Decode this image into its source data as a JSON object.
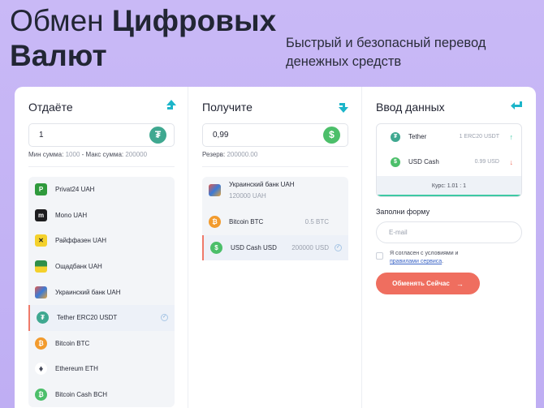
{
  "hero": {
    "title_light": "Обмен",
    "title_bold_1": "Цифровых",
    "title_bold_2": "Валют",
    "subtitle": "Быстрый и безопасный перевод денежных средств"
  },
  "give": {
    "title": "Отдаёте",
    "amount": "1",
    "currency_icon": "tether-icon",
    "min_label": "Мин сумма:",
    "min_value": "1000",
    "max_label": "- Макс сумма:",
    "max_value": "200000",
    "items": [
      {
        "label": "Privat24 UAH",
        "icon": "privat24-icon",
        "color": "#2f9a3c"
      },
      {
        "label": "Mono UAH",
        "icon": "monobank-icon",
        "color": "#1d1d1f"
      },
      {
        "label": "Райффазен UAH",
        "icon": "raiffeisen-icon",
        "color": "#f4d12c"
      },
      {
        "label": "Ощадбанк UAH",
        "icon": "oschadbank-icon",
        "color": "#2f8f4a"
      },
      {
        "label": "Украинский банк UAH",
        "icon": "ukrbank-icon",
        "color": "#e3a13a"
      },
      {
        "label": "Tether ERC20 USDT",
        "icon": "tether-icon",
        "color": "#3fa890",
        "active": true
      },
      {
        "label": "Bitcoin BTC",
        "icon": "bitcoin-icon",
        "color": "#f29b2e"
      },
      {
        "label": "Ethereum ETH",
        "icon": "ethereum-icon",
        "color": "#454a5a"
      },
      {
        "label": "Bitcoin Cash BCH",
        "icon": "bitcoin-cash-icon",
        "color": "#4cbf6a"
      }
    ]
  },
  "get": {
    "title": "Получите",
    "amount": "0,99",
    "currency_icon": "usd-icon",
    "reserve_label": "Резерв:",
    "reserve_value": "200000.00",
    "items": [
      {
        "label": "Украинский банк UAH",
        "sub": "120000 UAH",
        "icon": "ukrbank-icon",
        "color": "#e3a13a"
      },
      {
        "label": "Bitcoin BTC",
        "amount": "0.5 BTC",
        "icon": "bitcoin-icon",
        "color": "#f29b2e"
      },
      {
        "label": "USD Cash USD",
        "amount": "200000 USD",
        "icon": "usd-icon",
        "color": "#4cbf6a",
        "active": true
      }
    ]
  },
  "input": {
    "title": "Ввод данных",
    "from_name": "Tether",
    "from_value": "1 ERC20 USDT",
    "to_name": "USD Cash",
    "to_value": "0.99 USD",
    "rate": "Курс: 1.01 : 1",
    "form_label": "Заполни форму",
    "email_placeholder": "E-mail",
    "agree_text": "Я согласен с условиями и",
    "agree_link": "правилами сервиса",
    "agree_end": ".",
    "submit": "Обменять Сейчас",
    "accent": "#ef6e5f",
    "teal": "#1cb5c9"
  }
}
